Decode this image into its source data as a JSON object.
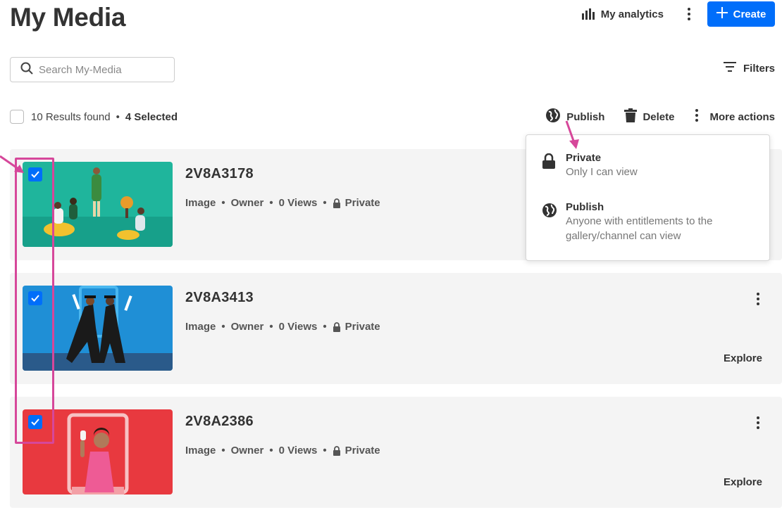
{
  "header": {
    "title": "My Media",
    "analytics_label": "My analytics",
    "create_label": "Create"
  },
  "search": {
    "placeholder": "Search My-Media"
  },
  "filters_label": "Filters",
  "bulk_bar": {
    "results_text": "10 Results found",
    "selected_text": "4 Selected",
    "publish_label": "Publish",
    "delete_label": "Delete",
    "more_actions_label": "More actions"
  },
  "publish_menu": {
    "private_title": "Private",
    "private_desc": "Only I can view",
    "publish_title": "Publish",
    "publish_desc": "Anyone with entitlements to the gallery/channel can view"
  },
  "entries": [
    {
      "title": "2V8A3178",
      "type": "Image",
      "role": "Owner",
      "views": "0 Views",
      "privacy": "Private",
      "selected": true,
      "thumb_color": "#1fb59c"
    },
    {
      "title": "2V8A3413",
      "type": "Image",
      "role": "Owner",
      "views": "0 Views",
      "privacy": "Private",
      "selected": true,
      "explore_label": "Explore",
      "thumb_color": "#1f8fd6"
    },
    {
      "title": "2V8A2386",
      "type": "Image",
      "role": "Owner",
      "views": "0 Views",
      "privacy": "Private",
      "selected": true,
      "explore_label": "Explore",
      "thumb_color": "#e8393f"
    }
  ],
  "colors": {
    "accent": "#006efa",
    "annotation": "#d6479a",
    "row_background": "#f4f4f4"
  }
}
